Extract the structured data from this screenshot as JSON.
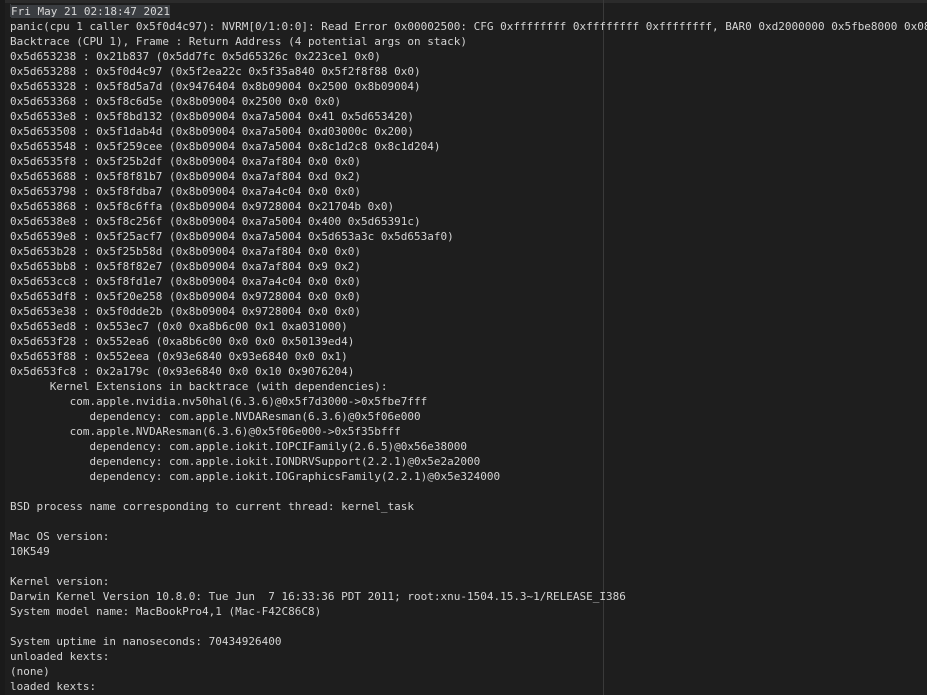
{
  "log": {
    "lines": [
      "Fri May 21 02:18:47 2021",
      "panic(cpu 1 caller 0x5f0d4c97): NVRM[0/1:0:0]: Read Error 0x00002500: CFG 0xffffffff 0xffffffff 0xffffffff, BAR0 0xd2000000 0x5fbe8000 0x08",
      "Backtrace (CPU 1), Frame : Return Address (4 potential args on stack)",
      "0x5d653238 : 0x21b837 (0x5dd7fc 0x5d65326c 0x223ce1 0x0)",
      "0x5d653288 : 0x5f0d4c97 (0x5f2ea22c 0x5f35a840 0x5f2f8f88 0x0)",
      "0x5d653328 : 0x5f8d5a7d (0x9476404 0x8b09004 0x2500 0x8b09004)",
      "0x5d653368 : 0x5f8c6d5e (0x8b09004 0x2500 0x0 0x0)",
      "0x5d6533e8 : 0x5f8bd132 (0x8b09004 0xa7a5004 0x41 0x5d653420)",
      "0x5d653508 : 0x5f1dab4d (0x8b09004 0xa7a5004 0xd03000c 0x200)",
      "0x5d653548 : 0x5f259cee (0x8b09004 0xa7a5004 0x8c1d2c8 0x8c1d204)",
      "0x5d6535f8 : 0x5f25b2df (0x8b09004 0xa7af804 0x0 0x0)",
      "0x5d653688 : 0x5f8f81b7 (0x8b09004 0xa7af804 0xd 0x2)",
      "0x5d653798 : 0x5f8fdba7 (0x8b09004 0xa7a4c04 0x0 0x0)",
      "0x5d653868 : 0x5f8c6ffa (0x8b09004 0x9728004 0x21704b 0x0)",
      "0x5d6538e8 : 0x5f8c256f (0x8b09004 0xa7a5004 0x400 0x5d65391c)",
      "0x5d6539e8 : 0x5f25acf7 (0x8b09004 0xa7a5004 0x5d653a3c 0x5d653af0)",
      "0x5d653b28 : 0x5f25b58d (0x8b09004 0xa7af804 0x0 0x0)",
      "0x5d653bb8 : 0x5f8f82e7 (0x8b09004 0xa7af804 0x9 0x2)",
      "0x5d653cc8 : 0x5f8fd1e7 (0x8b09004 0xa7a4c04 0x0 0x0)",
      "0x5d653df8 : 0x5f20e258 (0x8b09004 0x9728004 0x0 0x0)",
      "0x5d653e38 : 0x5f0dde2b (0x8b09004 0x9728004 0x0 0x0)",
      "0x5d653ed8 : 0x553ec7 (0x0 0xa8b6c00 0x1 0xa031000)",
      "0x5d653f28 : 0x552ea6 (0xa8b6c00 0x0 0x0 0x50139ed4)",
      "0x5d653f88 : 0x552eea (0x93e6840 0x93e6840 0x0 0x1)",
      "0x5d653fc8 : 0x2a179c (0x93e6840 0x0 0x10 0x9076204)",
      "      Kernel Extensions in backtrace (with dependencies):",
      "         com.apple.nvidia.nv50hal(6.3.6)@0x5f7d3000->0x5fbe7fff",
      "            dependency: com.apple.NVDAResman(6.3.6)@0x5f06e000",
      "         com.apple.NVDAResman(6.3.6)@0x5f06e000->0x5f35bfff",
      "            dependency: com.apple.iokit.IOPCIFamily(2.6.5)@0x56e38000",
      "            dependency: com.apple.iokit.IONDRVSupport(2.2.1)@0x5e2a2000",
      "            dependency: com.apple.iokit.IOGraphicsFamily(2.2.1)@0x5e324000",
      "",
      "BSD process name corresponding to current thread: kernel_task",
      "",
      "Mac OS version:",
      "10K549",
      "",
      "Kernel version:",
      "Darwin Kernel Version 10.8.0: Tue Jun  7 16:33:36 PDT 2011; root:xnu-1504.15.3~1/RELEASE_I386",
      "System model name: MacBookPro4,1 (Mac-F42C86C8)",
      "",
      "System uptime in nanoseconds: 70434926400",
      "unloaded kexts:",
      "(none)",
      "loaded kexts:"
    ]
  }
}
